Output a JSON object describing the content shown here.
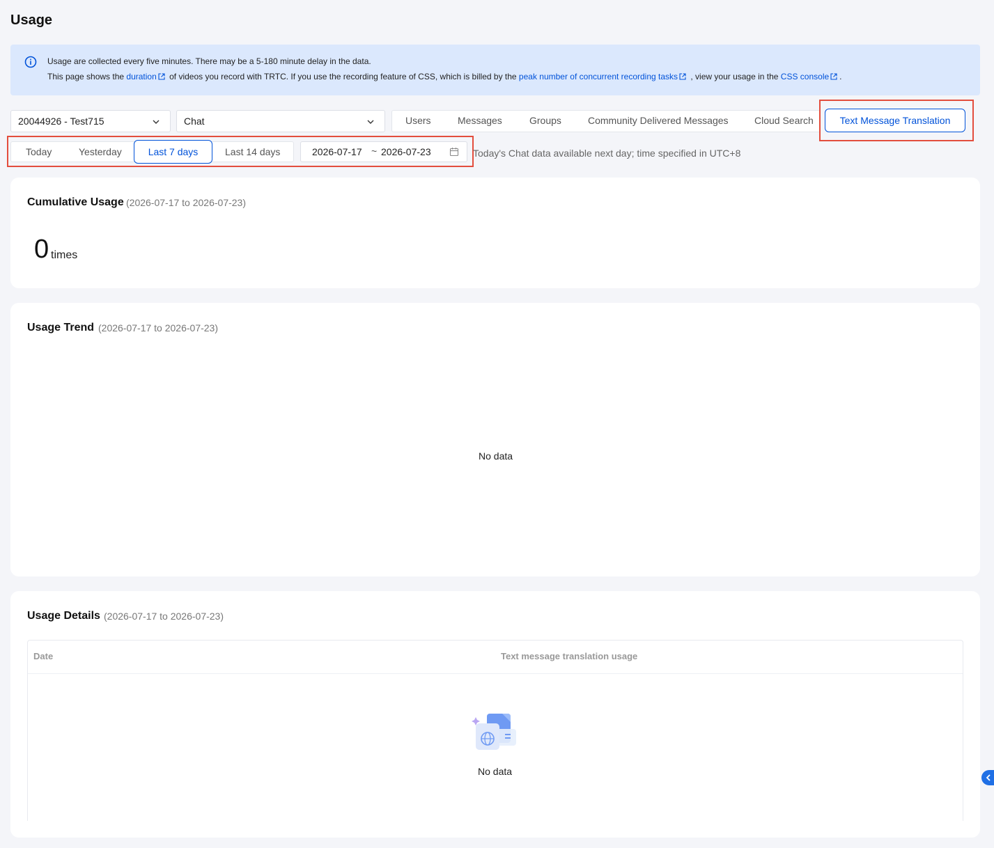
{
  "page": {
    "title": "Usage"
  },
  "notice": {
    "line1": "Usage are collected every five minutes. There may be a 5-180 minute delay in the data.",
    "line2_a": "This page shows the ",
    "link_duration": "duration",
    "line2_b": " of videos you record with TRTC. If you use the recording feature of CSS, which is billed by the ",
    "link_peak": "peak number of concurrent recording tasks",
    "line2_c": " , view your usage in the ",
    "link_console": "CSS console",
    "line2_d": "."
  },
  "filters": {
    "app_select": "20044926 - Test715",
    "product_select": "Chat",
    "tabs": [
      "Users",
      "Messages",
      "Groups",
      "Community Delivered Messages",
      "Cloud Search"
    ],
    "active_tab": "Text Message Translation",
    "ranges": [
      "Today",
      "Yesterday",
      "Last 14 days"
    ],
    "active_range": "Last 7 days",
    "date_start": "2026-07-17",
    "date_sep": "~",
    "date_end": "2026-07-23",
    "hint": "Today's Chat data available next day; time specified in UTC+8"
  },
  "cumulative": {
    "title": "Cumulative Usage",
    "range": "(2026-07-17 to 2026-07-23)",
    "value": "0",
    "unit": "times"
  },
  "trend": {
    "title": "Usage Trend",
    "range": "(2026-07-17 to 2026-07-23)",
    "empty": "No data"
  },
  "details": {
    "title": "Usage Details",
    "range": "(2026-07-17 to 2026-07-23)",
    "columns": [
      "Date",
      "Text message translation usage"
    ],
    "rows": [],
    "empty": "No data"
  },
  "colors": {
    "accent": "#0052d9",
    "highlight": "#e34d3d",
    "notice_bg": "#dbe8fd"
  }
}
